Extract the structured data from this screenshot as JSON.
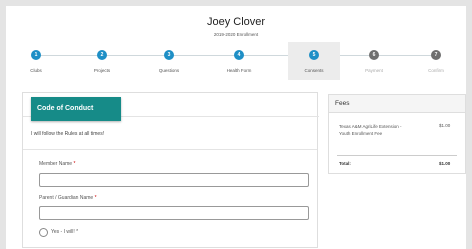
{
  "header": {
    "name": "Joey Clover",
    "enrollment": "2019-2020 Enrollment"
  },
  "steps": [
    {
      "num": "1",
      "label": "Clubs",
      "state": "done"
    },
    {
      "num": "2",
      "label": "Projects",
      "state": "done"
    },
    {
      "num": "3",
      "label": "Questions",
      "state": "done"
    },
    {
      "num": "4",
      "label": "Health Form",
      "state": "done"
    },
    {
      "num": "5",
      "label": "Consents",
      "state": "active"
    },
    {
      "num": "6",
      "label": "Payment",
      "state": "todo"
    },
    {
      "num": "7",
      "label": "Confirm",
      "state": "todo"
    }
  ],
  "form": {
    "tab_label": "Code of Conduct",
    "statement": "I will follow the Rules at all times!",
    "member_name_label": "Member Name",
    "parent_name_label": "Parent / Guardian Name",
    "required_marker": "*",
    "member_name_value": "",
    "parent_name_value": "",
    "radio_label": "Yes - I will!"
  },
  "fees": {
    "title": "Fees",
    "item_label": "Texas A&M AgriLife Extension - Youth Enrollment Fee",
    "item_amount": "$1.00",
    "total_label": "Total:",
    "total_amount": "$1.00"
  },
  "colors": {
    "step_done": "#1e8fc6",
    "step_todo": "#6f6f6f",
    "tab_accent": "#168b88",
    "page_bg": "#e4e4e4"
  }
}
